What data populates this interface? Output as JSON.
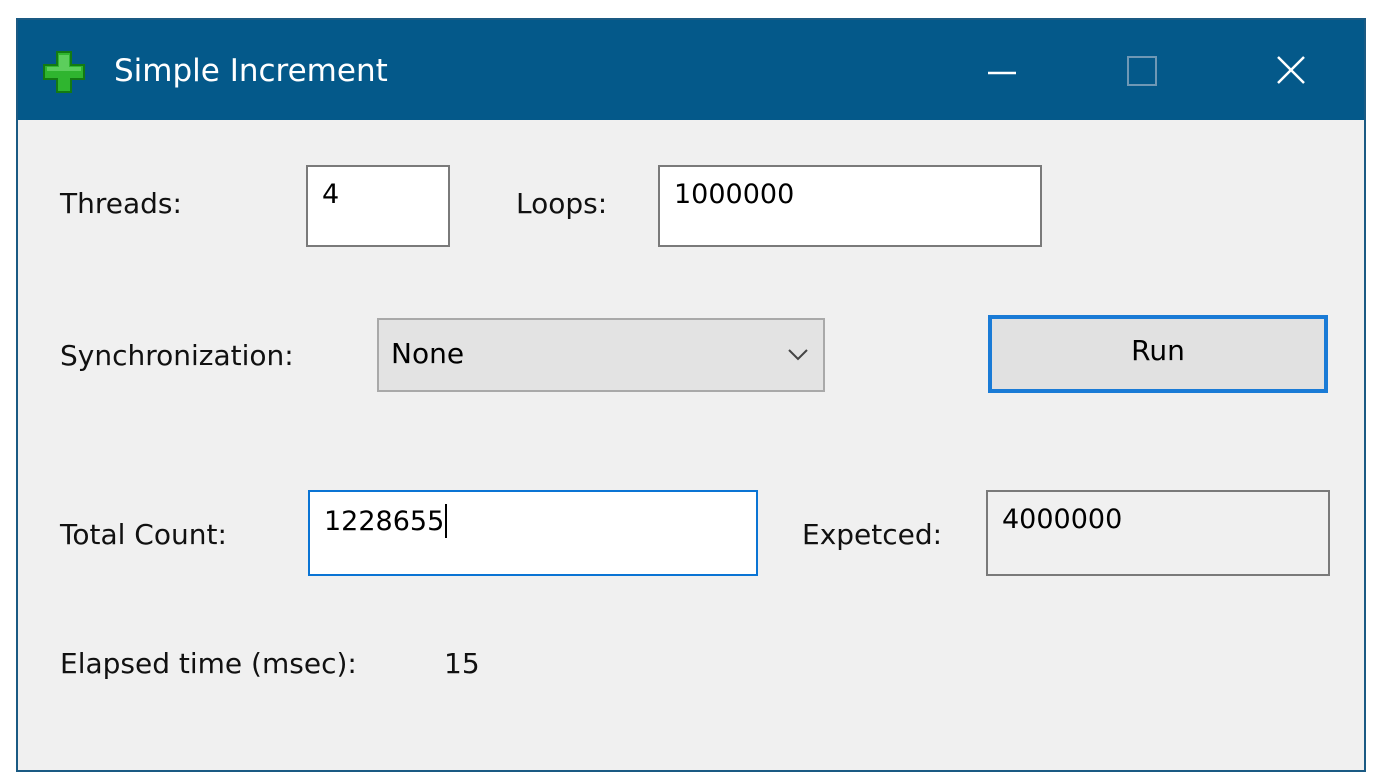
{
  "window": {
    "title": "Simple Increment",
    "app_icon": "green-plus-icon",
    "titlebar_color": "#04598a",
    "accent_color": "#1a7bd6"
  },
  "titlebar_controls": {
    "minimize_icon": "minimize-icon",
    "maximize_icon": "maximize-icon",
    "close_icon": "close-icon"
  },
  "form": {
    "threads_label": "Threads:",
    "threads_value": "4",
    "loops_label": "Loops:",
    "loops_value": "1000000",
    "sync_label": "Synchronization:",
    "sync_selected": "None",
    "run_label": "Run",
    "total_label": "Total Count:",
    "total_value": "1228655",
    "expected_label": "Expetced:",
    "expected_value": "4000000",
    "elapsed_label": "Elapsed time (msec):",
    "elapsed_value": "15"
  }
}
